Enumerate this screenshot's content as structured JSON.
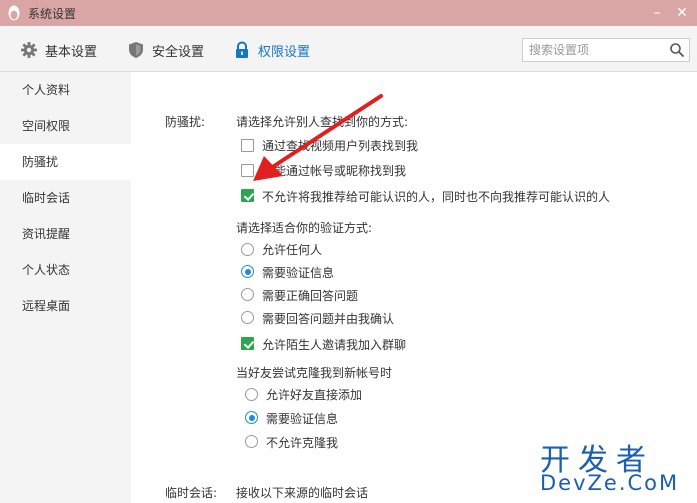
{
  "window": {
    "title": "系统设置",
    "minimize": "–",
    "close": "✕"
  },
  "toolbar": {
    "tabs": [
      {
        "label": "基本设置",
        "icon": "gear-icon"
      },
      {
        "label": "安全设置",
        "icon": "shield-icon"
      },
      {
        "label": "权限设置",
        "icon": "lock-icon",
        "active": true
      }
    ],
    "search": {
      "placeholder": "搜索设置项",
      "value": ""
    }
  },
  "sidebar": {
    "items": [
      {
        "label": "个人资料"
      },
      {
        "label": "空间权限"
      },
      {
        "label": "防骚扰",
        "active": true
      },
      {
        "label": "临时会话"
      },
      {
        "label": "资讯提醒"
      },
      {
        "label": "个人状态"
      },
      {
        "label": "远程桌面"
      }
    ]
  },
  "main": {
    "section_label": "防骚扰:",
    "find_prompt": "请选择允许别人查找到你的方式:",
    "find_options": [
      {
        "label": "通过查找视频用户列表找到我",
        "checked": false
      },
      {
        "label": "只能通过帐号或昵称找到我",
        "checked": false
      },
      {
        "label": "不允许将我推荐给可能认识的人，同时也不向我推荐可能认识的人",
        "checked": true
      }
    ],
    "verify_prompt": "请选择适合你的验证方式:",
    "verify_options": [
      {
        "label": "允许任何人",
        "selected": false
      },
      {
        "label": "需要验证信息",
        "selected": true
      },
      {
        "label": "需要正确回答问题",
        "selected": false
      },
      {
        "label": "需要回答问题并由我确认",
        "selected": false
      }
    ],
    "group_invite": {
      "label": "允许陌生人邀请我加入群聊",
      "checked": true
    },
    "clone_prompt": "当好友尝试克隆我到新帐号时",
    "clone_options": [
      {
        "label": "允许好友直接添加",
        "selected": false
      },
      {
        "label": "需要验证信息",
        "selected": true
      },
      {
        "label": "不允许克隆我",
        "selected": false
      }
    ],
    "temp_section_label": "临时会话:",
    "temp_prompt": "接收以下来源的临时会话"
  },
  "watermark": {
    "line1": "开发者",
    "line2": "DevZe.CoM"
  },
  "colors": {
    "titlebar": "#d9a5a5",
    "accent": "#1677c8",
    "check_green": "#2da44e",
    "arrow_red": "#e02020",
    "watermark": "#1b5fb0"
  }
}
